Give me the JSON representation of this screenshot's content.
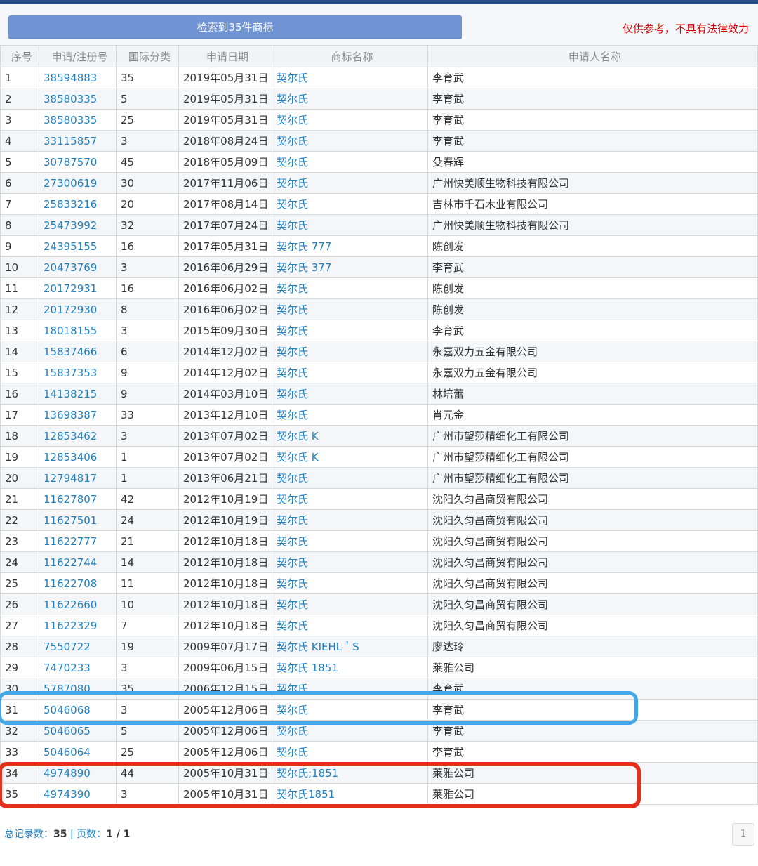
{
  "header": {
    "result_button": "检索到35件商标",
    "disclaimer": "仅供参考，不具有法律效力"
  },
  "table": {
    "columns": [
      "序号",
      "申请/注册号",
      "国际分类",
      "申请日期",
      "商标名称",
      "申请人名称"
    ],
    "rows": [
      [
        "1",
        "38594883",
        "35",
        "2019年05月31日",
        "契尔氏",
        "李育武"
      ],
      [
        "2",
        "38580335",
        "5",
        "2019年05月31日",
        "契尔氏",
        "李育武"
      ],
      [
        "3",
        "38580335",
        "25",
        "2019年05月31日",
        "契尔氏",
        "李育武"
      ],
      [
        "4",
        "33115857",
        "3",
        "2018年08月24日",
        "契尔氏",
        "李育武"
      ],
      [
        "5",
        "30787570",
        "45",
        "2018年05月09日",
        "契尔氏",
        "殳春辉"
      ],
      [
        "6",
        "27300619",
        "30",
        "2017年11月06日",
        "契尔氏",
        "广州快美顺生物科技有限公司"
      ],
      [
        "7",
        "25833216",
        "20",
        "2017年08月14日",
        "契尔氏",
        "吉林市千石木业有限公司"
      ],
      [
        "8",
        "25473992",
        "32",
        "2017年07月24日",
        "契尔氏",
        "广州快美顺生物科技有限公司"
      ],
      [
        "9",
        "24395155",
        "16",
        "2017年05月31日",
        "契尔氏 777",
        "陈创发"
      ],
      [
        "10",
        "20473769",
        "3",
        "2016年06月29日",
        "契尔氏 377",
        "李育武"
      ],
      [
        "11",
        "20172931",
        "16",
        "2016年06月02日",
        "契尔氏",
        "陈创发"
      ],
      [
        "12",
        "20172930",
        "8",
        "2016年06月02日",
        "契尔氏",
        "陈创发"
      ],
      [
        "13",
        "18018155",
        "3",
        "2015年09月30日",
        "契尔氏",
        "李育武"
      ],
      [
        "14",
        "15837466",
        "6",
        "2014年12月02日",
        "契尔氏",
        "永嘉双力五金有限公司"
      ],
      [
        "15",
        "15837353",
        "9",
        "2014年12月02日",
        "契尔氏",
        "永嘉双力五金有限公司"
      ],
      [
        "16",
        "14138215",
        "9",
        "2014年03月10日",
        "契尔氏",
        "林培蕾"
      ],
      [
        "17",
        "13698387",
        "33",
        "2013年12月10日",
        "契尔氏",
        "肖元金"
      ],
      [
        "18",
        "12853462",
        "3",
        "2013年07月02日",
        "契尔氏 K",
        "广州市望莎精细化工有限公司"
      ],
      [
        "19",
        "12853406",
        "1",
        "2013年07月02日",
        "契尔氏 K",
        "广州市望莎精细化工有限公司"
      ],
      [
        "20",
        "12794817",
        "1",
        "2013年06月21日",
        "契尔氏",
        "广州市望莎精细化工有限公司"
      ],
      [
        "21",
        "11627807",
        "42",
        "2012年10月19日",
        "契尔氏",
        "沈阳久匀昌商贸有限公司"
      ],
      [
        "22",
        "11627501",
        "24",
        "2012年10月19日",
        "契尔氏",
        "沈阳久匀昌商贸有限公司"
      ],
      [
        "23",
        "11622777",
        "21",
        "2012年10月18日",
        "契尔氏",
        "沈阳久匀昌商贸有限公司"
      ],
      [
        "24",
        "11622744",
        "14",
        "2012年10月18日",
        "契尔氏",
        "沈阳久匀昌商贸有限公司"
      ],
      [
        "25",
        "11622708",
        "11",
        "2012年10月18日",
        "契尔氏",
        "沈阳久匀昌商贸有限公司"
      ],
      [
        "26",
        "11622660",
        "10",
        "2012年10月18日",
        "契尔氏",
        "沈阳久匀昌商贸有限公司"
      ],
      [
        "27",
        "11622329",
        "7",
        "2012年10月18日",
        "契尔氏",
        "沈阳久匀昌商贸有限公司"
      ],
      [
        "28",
        "7550722",
        "19",
        "2009年07月17日",
        "契尔氏 KIEHL＇S",
        "廖达玲"
      ],
      [
        "29",
        "7470233",
        "3",
        "2009年06月15日",
        "契尔氏 1851",
        "莱雅公司"
      ],
      [
        "30",
        "5787080",
        "35",
        "2006年12月15日",
        "契尔氏",
        "李育武"
      ],
      [
        "31",
        "5046068",
        "3",
        "2005年12月06日",
        "契尔氏",
        "李育武"
      ],
      [
        "32",
        "5046065",
        "5",
        "2005年12月06日",
        "契尔氏",
        "李育武"
      ],
      [
        "33",
        "5046064",
        "25",
        "2005年12月06日",
        "契尔氏",
        "李育武"
      ],
      [
        "34",
        "4974890",
        "44",
        "2005年10月31日",
        "契尔氏;1851",
        "莱雅公司"
      ],
      [
        "35",
        "4974390",
        "3",
        "2005年10月31日",
        "契尔氏1851",
        "莱雅公司"
      ]
    ]
  },
  "footer": {
    "total_label": "总记录数：",
    "total_value": "35",
    "separator": " | ",
    "pages_label": "页数：",
    "pages_value": "1 / 1",
    "page_button": "1"
  },
  "colors": {
    "link": "#1f7fbf",
    "highlight_blue": "#42a7e8",
    "highlight_red": "#e2301c",
    "disclaimer": "#d40000"
  }
}
